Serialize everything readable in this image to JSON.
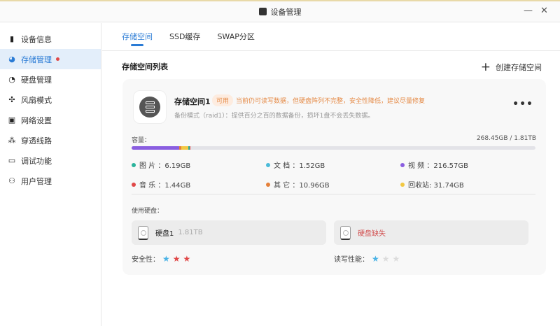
{
  "window": {
    "title": "设备管理",
    "minimize": "—",
    "close": "✕"
  },
  "sidebar": {
    "items": [
      {
        "label": "设备信息",
        "icon": "▮"
      },
      {
        "label": "存储管理",
        "icon": "◕",
        "active": true,
        "alert": true
      },
      {
        "label": "硬盘管理",
        "icon": "◔"
      },
      {
        "label": "风扇模式",
        "icon": "✣"
      },
      {
        "label": "网络设置",
        "icon": "▣"
      },
      {
        "label": "穿透线路",
        "icon": "⁂"
      },
      {
        "label": "调试功能",
        "icon": "▭"
      },
      {
        "label": "用户管理",
        "icon": "⚇"
      }
    ]
  },
  "tabs": [
    {
      "label": "存储空间",
      "active": true
    },
    {
      "label": "SSD缓存"
    },
    {
      "label": "SWAP分区"
    }
  ],
  "section": {
    "title": "存储空间列表",
    "create_label": "创建存储空间",
    "create_icon": "+"
  },
  "pool": {
    "name": "存储空间1",
    "status": "可用",
    "warning": "当前仍可读写数据，但硬盘阵列不完整，安全性降低，建议尽量修复",
    "description": "备份模式（raid1）：提供百分之百的数据备份，损坏1盘不会丢失数据。",
    "more": "•••",
    "capacity_label": "容量：",
    "capacity_value": "268.45GB / 1.81TB",
    "usage_fraction": 0.145,
    "categories": [
      {
        "label": "图 片 ：6.19GB",
        "color": "#2bb39b",
        "gb": 6.19
      },
      {
        "label": "文 档 ：1.52GB",
        "color": "#4bbbd9",
        "gb": 1.52
      },
      {
        "label": "视 频 ：216.57GB",
        "color": "#8a5ee0",
        "gb": 216.57
      },
      {
        "label": "音 乐 ：1.44GB",
        "color": "#e04848",
        "gb": 1.44
      },
      {
        "label": "其 它 ：10.96GB",
        "color": "#e5803a",
        "gb": 10.96
      },
      {
        "label": "回收站: 31.74GB",
        "color": "#f2c842",
        "gb": 31.74
      }
    ],
    "disks_label": "使用硬盘：",
    "disks": [
      {
        "name": "硬盘1",
        "size": "1.81TB"
      },
      {
        "missing": "硬盘缺失"
      }
    ],
    "safety": {
      "label": "安全性：",
      "value": 3,
      "max": 3
    },
    "performance": {
      "label": "读写性能：",
      "value": 1,
      "max": 3
    },
    "colors": {
      "star_blue": "#4bb3e6",
      "star_red": "#e04848",
      "star_gray": "#dcdcdc"
    }
  }
}
